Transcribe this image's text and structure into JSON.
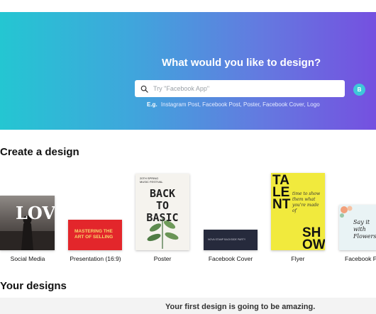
{
  "hero": {
    "title": "What would you like to design?",
    "search_placeholder": "Try \"Facebook App\"",
    "badge": "B",
    "examples_lead": "E.g.",
    "examples": [
      "Instagram Post,",
      "Facebook Post,",
      "Poster,",
      "Facebook Cover,",
      "Logo"
    ]
  },
  "create": {
    "title": "Create a design",
    "cards": [
      {
        "label": "Social Media",
        "thumb_text": "LOVE"
      },
      {
        "label": "Presentation (16:9)",
        "thumb_text": "MASTERING THE ART OF SELLING"
      },
      {
        "label": "Poster",
        "thumb_small": "20TH SPRING MUSIC FESTIVAL",
        "thumb_text": "BACK TO BASIC"
      },
      {
        "label": "Facebook Cover",
        "thumb_text": "NOVA STAMP BACKSIDE PARTY"
      },
      {
        "label": "Flyer",
        "thumb_top": "TA LE NT",
        "thumb_mid": "time to show them what you're made of",
        "thumb_bottom": "SH OW"
      },
      {
        "label": "Facebook P",
        "thumb_text": "Say it with Flowers"
      }
    ]
  },
  "yours": {
    "title": "Your designs",
    "empty_message": "Your first design is going to be amazing."
  },
  "colors": {
    "gradient_start": "#24c6d2",
    "gradient_end": "#7550e0",
    "badge": "#3ec7d9"
  }
}
